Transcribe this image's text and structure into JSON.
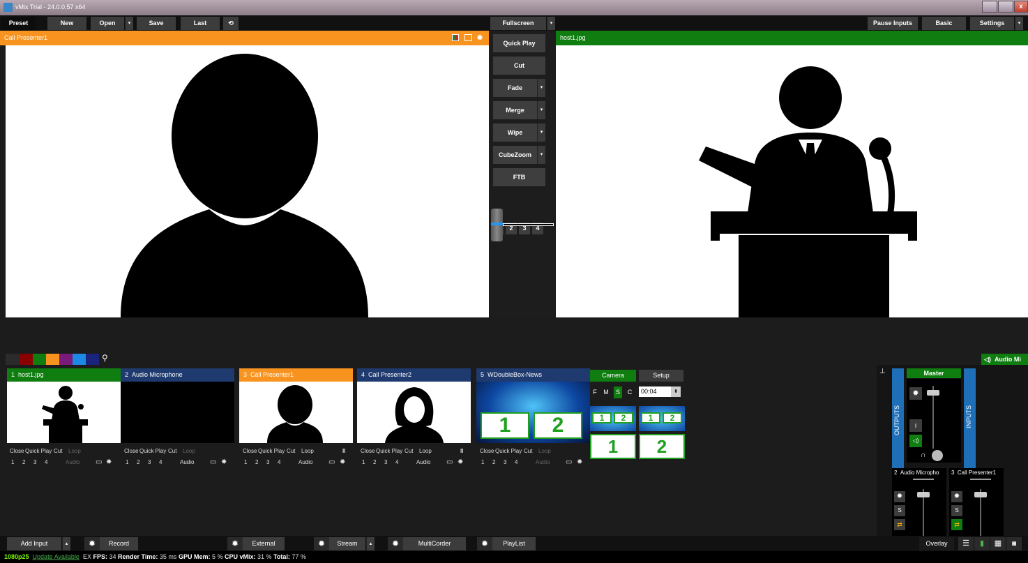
{
  "window": {
    "title": "vMix Trial - 24.0.0.57 x64"
  },
  "toolbar": {
    "preset": "Preset",
    "new": "New",
    "open": "Open",
    "save": "Save",
    "last": "Last",
    "fullscreen": "Fullscreen",
    "pause_inputs": "Pause Inputs",
    "basic": "Basic",
    "settings": "Settings"
  },
  "preview": {
    "title": "Call Presenter1",
    "color": "#f7931e"
  },
  "output": {
    "title": "host1.jpg",
    "color": "#0f7d0f"
  },
  "transitions": {
    "quick_play": "Quick Play",
    "cut": "Cut",
    "fade": "Fade",
    "merge": "Merge",
    "wipe": "Wipe",
    "cubezoom": "CubeZoom",
    "ftb": "FTB",
    "numbers": [
      "1",
      "2",
      "3",
      "4"
    ]
  },
  "color_filters": [
    "#8b0000",
    "#0f7d0f",
    "#f7931e",
    "#7a1a7a",
    "#1e88e5",
    "#1a237e"
  ],
  "inputs": [
    {
      "number": "1",
      "name": "host1.jpg",
      "header_color": "#0f7d0f"
    },
    {
      "number": "2",
      "name": "Audio Microphone",
      "header_color": "#1f3a6e"
    },
    {
      "number": "3",
      "name": "Call Presenter1",
      "header_color": "#f7931e"
    },
    {
      "number": "4",
      "name": "Call Presenter2",
      "header_color": "#1f3a6e"
    },
    {
      "number": "5",
      "name": "WDoubleBox-News",
      "header_color": "#1f3a6e"
    }
  ],
  "input_controls": {
    "close": "Close",
    "quick_play": "Quick Play",
    "cut": "Cut",
    "loop": "Loop",
    "audio": "Audio",
    "nums": [
      "1",
      "2",
      "3",
      "4"
    ],
    "pause_glyph": "II"
  },
  "layers": {
    "camera": "Camera",
    "setup": "Setup",
    "f": "F",
    "m": "M",
    "s": "S",
    "c": "C",
    "time": "00:04",
    "one": "1",
    "two": "2"
  },
  "audio_mixer": {
    "header": "Audio Mi",
    "master": "Master",
    "outputs": "OUTPUTS",
    "inputs": "INPUTS",
    "i_label": "i",
    "s_label": "S",
    "channels": [
      {
        "number": "2",
        "name": "Audio Micropho"
      },
      {
        "number": "3",
        "name": "Call Presenter1"
      }
    ]
  },
  "bottom": {
    "add_input": "Add Input",
    "record": "Record",
    "external": "External",
    "stream": "Stream",
    "multicorder": "MultiCorder",
    "playlist": "PlayList",
    "overlay": "Overlay"
  },
  "status": {
    "format": "1080p25",
    "update": "Update Available",
    "ex": "EX",
    "fps_label": "FPS:",
    "fps": "34",
    "render_label": "Render Time:",
    "render": "35 ms",
    "gpu_label": "GPU Mem:",
    "gpu": "5 %",
    "cpu_label": "CPU vMix:",
    "cpu": "31 %",
    "total_label": "Total:",
    "total": "77 %"
  }
}
